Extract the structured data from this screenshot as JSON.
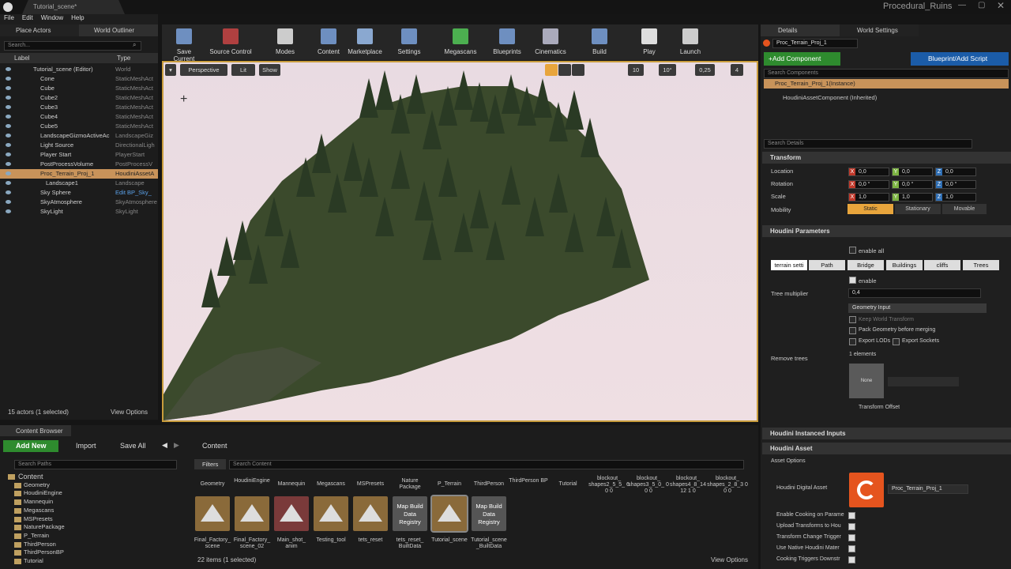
{
  "app": {
    "tab_title": "Tutorial_scene*",
    "project_name": "Procedural_Ruins"
  },
  "menu": [
    "File",
    "Edit",
    "Window",
    "Help"
  ],
  "left_tabs": {
    "place_actors": "Place Actors",
    "world_outliner": "World Outliner"
  },
  "outliner": {
    "search_placeholder": "Search...",
    "col_label": "Label",
    "col_type": "Type",
    "rows": [
      {
        "label": "Tutorial_scene (Editor)",
        "type": "World"
      },
      {
        "label": "Cone",
        "type": "StaticMeshAct"
      },
      {
        "label": "Cube",
        "type": "StaticMeshAct"
      },
      {
        "label": "Cube2",
        "type": "StaticMeshAct"
      },
      {
        "label": "Cube3",
        "type": "StaticMeshAct"
      },
      {
        "label": "Cube4",
        "type": "StaticMeshAct"
      },
      {
        "label": "Cube5",
        "type": "StaticMeshAct"
      },
      {
        "label": "LandscapeGizmoActiveAc",
        "type": "LandscapeGiz"
      },
      {
        "label": "Light Source",
        "type": "DirectionalLigh"
      },
      {
        "label": "Player Start",
        "type": "PlayerStart"
      },
      {
        "label": "PostProcessVolume",
        "type": "PostProcessV"
      },
      {
        "label": "Proc_Terrain_Proj_1",
        "type": "HoudiniAssetA"
      },
      {
        "label": "Landscape1",
        "type": "Landscape"
      },
      {
        "label": "Sky Sphere",
        "type": "Edit BP_Sky_"
      },
      {
        "label": "SkyAtmosphere",
        "type": "SkyAtmosphere"
      },
      {
        "label": "SkyLight",
        "type": "SkyLight"
      }
    ],
    "status": "15 actors (1 selected)",
    "view_options": "View Options"
  },
  "toolbar": [
    "Save Current",
    "Source Control",
    "Modes",
    "Content",
    "Marketplace",
    "Settings",
    "Megascans",
    "Blueprints",
    "Cinematics",
    "Build",
    "Play",
    "Launch"
  ],
  "viewport": {
    "perspective": "Perspective",
    "lit": "Lit",
    "show": "Show",
    "grid": "10",
    "angle": "10°",
    "scale": "0,25",
    "cam": "4"
  },
  "details": {
    "tab": "Details",
    "tab2": "World Settings",
    "actor_name": "Proc_Terrain_Proj_1",
    "add_component": "+Add Component",
    "blueprint": "Blueprint/Add Script",
    "search_components": "Search Components",
    "instance": "Proc_Terrain_Proj_1(Instance)",
    "component": "HoudiniAssetComponent (Inherited)",
    "search_details": "Search Details",
    "transform": "Transform",
    "location": "Location",
    "rotation": "Rotation",
    "scale": "Scale",
    "mobility": "Mobility",
    "loc": [
      "0,0",
      "0,0",
      "0,0"
    ],
    "rot": [
      "0,0 °",
      "0,0 °",
      "0,0 °"
    ],
    "scl": [
      "1,0",
      "1,0",
      "1,0"
    ],
    "mob": [
      "Static",
      "Stationary",
      "Movable"
    ],
    "houdini_params": "Houdini Parameters",
    "enable_all": "enable all",
    "param_tabs": [
      "terrain setti",
      "Path",
      "Bridge",
      "Buildings",
      "cliffs",
      "Trees"
    ],
    "enable": "enable",
    "tree_mult_label": "Tree multiplier",
    "tree_mult": "0,4",
    "geo_input": "Geometry Input",
    "keep_world": "Keep World Transform",
    "pack_geo": "Pack Geometry before merging",
    "export_lods": "Export LODs",
    "export_sockets": "Export Sockets",
    "remove_trees": "Remove trees",
    "elements": "1 elements",
    "none": "None",
    "transform_offset": "Transform Offset",
    "instanced_inputs": "Houdini Instanced Inputs",
    "houdini_asset": "Houdini Asset",
    "asset_options": "Asset Options",
    "hda_label": "Houdini Digital Asset",
    "hda_value": "Proc_Terrain_Proj_1",
    "options": [
      "Enable Cooking on Parame",
      "Upload Transforms to Hou",
      "Transform Change Trigger",
      "Use Native Houdini Mater",
      "Cooking Triggers Downstr"
    ]
  },
  "content_browser": {
    "tab": "Content Browser",
    "add_new": "Add New",
    "import": "Import",
    "save_all": "Save All",
    "path": "Content",
    "search_paths": "Search Paths",
    "filters": "Filters",
    "search_content": "Search Content",
    "tree": [
      "Content",
      "Geometry",
      "HoudiniEngine",
      "Mannequin",
      "Megascans",
      "MSPresets",
      "NaturePackage",
      "P_Terrain",
      "ThirdPerson",
      "ThirdPersonBP",
      "Tutorial"
    ],
    "folders": [
      "Geometry",
      "HoudiniEngine",
      "Mannequin",
      "Megascans",
      "MSPresets",
      "Nature Package",
      "P_Terrain",
      "ThirdPerson",
      "ThirdPerson BP",
      "Tutorial"
    ],
    "meshes": [
      "blockout_ shapes2_5_5_ 6 0 0",
      "blockout_ shapes3_5_0_ 0 0 0",
      "blockout_ shapes4_8_14 12 1 0",
      "blockout_ shapes_2_8_3 0 0 0"
    ],
    "assets": [
      {
        "name": "Final_Factory_ scene"
      },
      {
        "name": "Final_Factory_ scene_02"
      },
      {
        "name": "Main_shot_ anim"
      },
      {
        "name": "Testing_tool"
      },
      {
        "name": "tets_reset"
      },
      {
        "name": "tets_reset_ BuiltData",
        "thumb": "Map Build Data Registry"
      },
      {
        "name": "Tutorial_scene"
      },
      {
        "name": "Tutorial_scene _BuiltData",
        "thumb": "Map Build Data Registry"
      }
    ],
    "status": "22 items (1 selected)",
    "view_options": "View Options"
  }
}
